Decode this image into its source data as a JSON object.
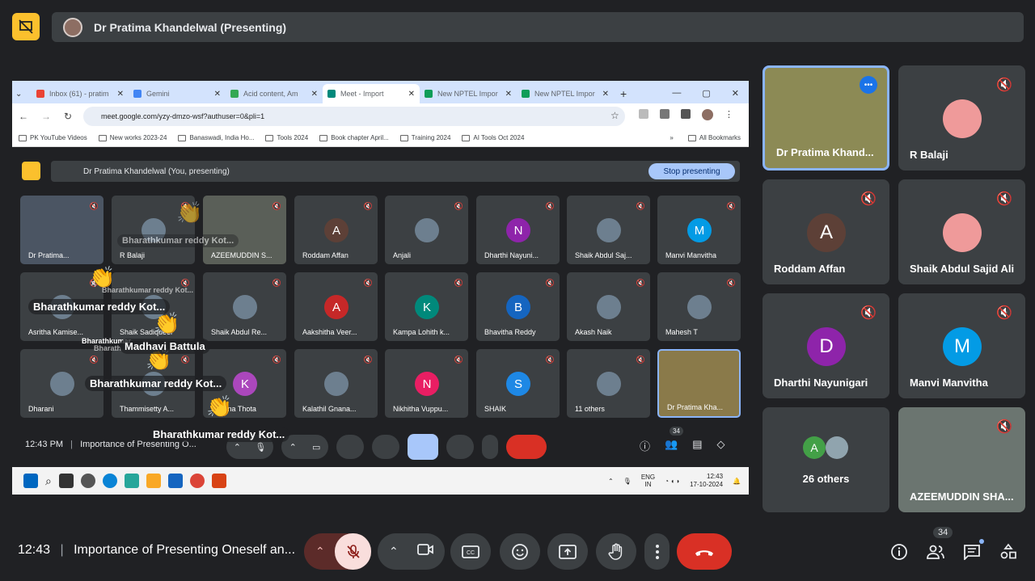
{
  "top": {
    "presenter_label": "Dr Pratima Khandelwal (Presenting)"
  },
  "browser": {
    "tabs": [
      {
        "title": "Inbox (61) - pratim",
        "color": "#ea4335"
      },
      {
        "title": "Gemini",
        "color": "#4285f4"
      },
      {
        "title": "Acid content, Am",
        "color": "#34a853"
      },
      {
        "title": "Meet - Import",
        "color": "#00897b"
      },
      {
        "title": "New NPTEL Impor",
        "color": "#0f9d58"
      },
      {
        "title": "New NPTEL Impor",
        "color": "#0f9d58"
      }
    ],
    "url": "meet.google.com/yzy-dmzo-wsf?authuser=0&pli=1",
    "bookmarks": [
      "PK YouTube Videos",
      "New works 2023-24",
      "Banaswadi, India Ho...",
      "Tools 2024",
      "Book chapter April...",
      "Training 2024",
      "AI Tools Oct 2024"
    ],
    "all_bookmarks": "All Bookmarks"
  },
  "inner": {
    "presenting_label": "Dr Pratima Khandelwal (You, presenting)",
    "stop_label": "Stop presenting",
    "tiles": [
      {
        "name": "Dr Pratima..."
      },
      {
        "name": "R Balaji"
      },
      {
        "name": "AZEEMUDDIN S..."
      },
      {
        "name": "Roddam Affan",
        "initial": "A",
        "color": "#5d4037"
      },
      {
        "name": "Anjali"
      },
      {
        "name": "Dharthi Nayuni...",
        "initial": "N",
        "color": "#8e24aa"
      },
      {
        "name": "Shaik Abdul Saj..."
      },
      {
        "name": "Manvi Manvitha",
        "initial": "M",
        "color": "#039be5"
      },
      {
        "name": "Asritha Kamise..."
      },
      {
        "name": "Shaik Sadiqueer"
      },
      {
        "name": "Shaik Abdul Re..."
      },
      {
        "name": "Aakshitha Veer...",
        "initial": "A",
        "color": "#c62828"
      },
      {
        "name": "Kampa Lohith k...",
        "initial": "K",
        "color": "#00897b"
      },
      {
        "name": "Bhavitha Reddy",
        "initial": "B",
        "color": "#1565c0"
      },
      {
        "name": "Akash Naik"
      },
      {
        "name": "Mahesh T"
      },
      {
        "name": "Dharani"
      },
      {
        "name": "Thammisetty A..."
      },
      {
        "name": "Krishna Thota",
        "initial": "K",
        "color": "#ab47bc"
      },
      {
        "name": "Kalathil Gnana..."
      },
      {
        "name": "Nikhitha Vuppu...",
        "initial": "N",
        "color": "#e91e63"
      },
      {
        "name": "SHAIK",
        "initial": "S",
        "color": "#1e88e5"
      },
      {
        "name": "11 others"
      },
      {
        "name": "Dr Pratima Kha..."
      }
    ],
    "time": "12:43 PM",
    "meeting_title": "Importance of Presenting O...",
    "participants": "34",
    "taskbar_lang": "ENG",
    "taskbar_region": "IN",
    "taskbar_time": "12:43",
    "taskbar_date": "17-10-2024"
  },
  "reactions": {
    "r1": "Bharathkumar reddy Kot...",
    "r2": "Madhavi Battula",
    "r3": "Bharathkumar reddy Kot...",
    "r4": "Bharathkumar reddy Kot...",
    "r5": "Bharathkumar reddy Kot...",
    "r6": "Bharathkumar reddy Kot...",
    "r7": "Bharathkumar",
    "r8": "Bharath"
  },
  "right_tiles": [
    {
      "name": "Dr Pratima Khand..."
    },
    {
      "name": "R Balaji"
    },
    {
      "name": "Roddam Affan",
      "initial": "A",
      "color": "#5d4037"
    },
    {
      "name": "Shaik Abdul Sajid Ali"
    },
    {
      "name": "Dharthi Nayunigari",
      "initial": "D",
      "color": "#8e24aa"
    },
    {
      "name": "Manvi Manvitha",
      "initial": "M",
      "color": "#039be5"
    },
    {
      "name": "26 others"
    },
    {
      "name": "AZEEMUDDIN SHA..."
    }
  ],
  "bottom": {
    "time": "12:43",
    "title": "Importance of Presenting Oneself an...",
    "participant_count": "34"
  }
}
